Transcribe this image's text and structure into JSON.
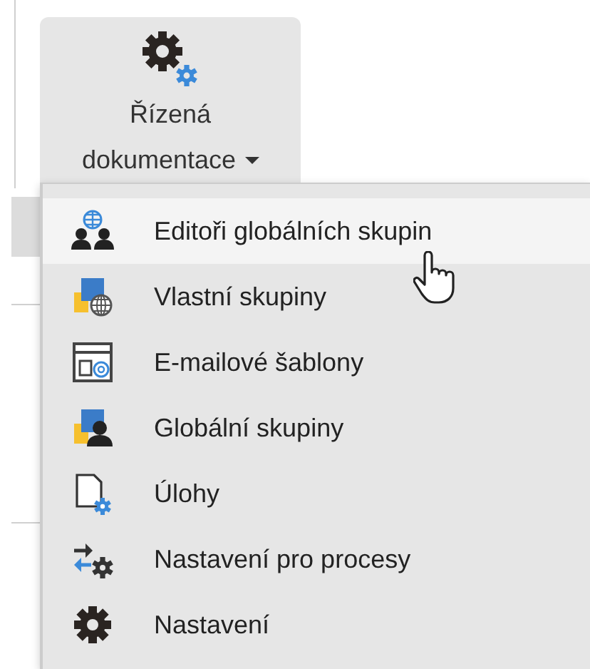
{
  "ribbon_button": {
    "label_lines": [
      "Řízená",
      "dokumentace"
    ],
    "expanded": true
  },
  "menu": {
    "items": [
      {
        "label": "Editoři globálních skupin",
        "selected": true
      },
      {
        "label": "Vlastní skupiny",
        "selected": false
      },
      {
        "label": "E-mailové šablony",
        "selected": false
      },
      {
        "label": "Globální skupiny",
        "selected": false
      },
      {
        "label": "Úlohy",
        "selected": false
      },
      {
        "label": "Nastavení pro procesy",
        "selected": false
      },
      {
        "label": "Nastavení",
        "selected": false
      }
    ]
  }
}
